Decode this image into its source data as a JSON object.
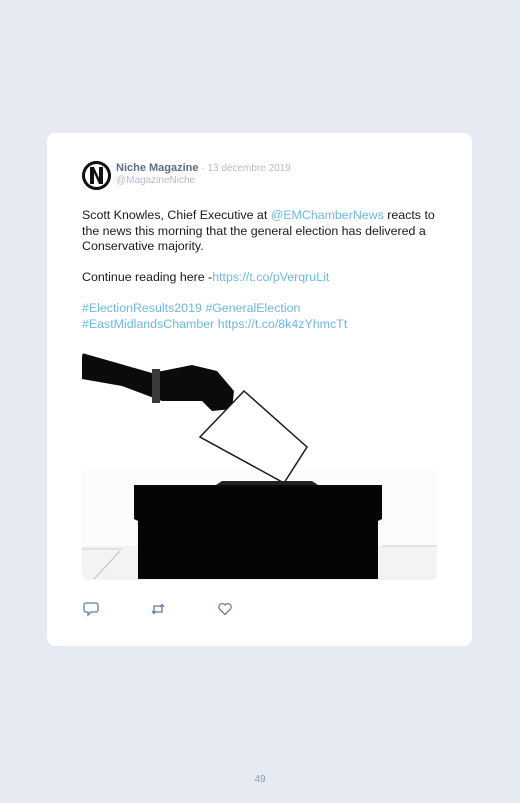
{
  "tweet": {
    "author_name": "Niche Magazine",
    "separator": " · ",
    "date": "13 décembre 2019",
    "handle": "@MagazineNiche",
    "avatar_letter": "N",
    "text_1": "Scott Knowles, Chief Executive at ",
    "mention": "@EMChamberNews",
    "text_2": " reacts to the news this morning that the general election has delivered a Conservative majority.",
    "continue_text": "Continue reading here -",
    "link_1": "https://t.co/pVerqruLit",
    "hashtag_1": "#ElectionResults2019",
    "hashtag_2": "#GeneralElection",
    "hashtag_3": "#EastMidlandsChamber",
    "link_2": "https://t.co/8k4zYhmcTt",
    "image_icon": "ballot-box-photo",
    "actions": {
      "reply_icon": "reply-icon",
      "retweet_icon": "retweet-icon",
      "like_icon": "heart-icon"
    }
  },
  "page": {
    "number": "49"
  },
  "colors": {
    "background": "#e6eaf2",
    "card": "#ffffff",
    "link": "#6cb8e6",
    "author": "#5d6f85",
    "meta": "#b3bccb"
  }
}
